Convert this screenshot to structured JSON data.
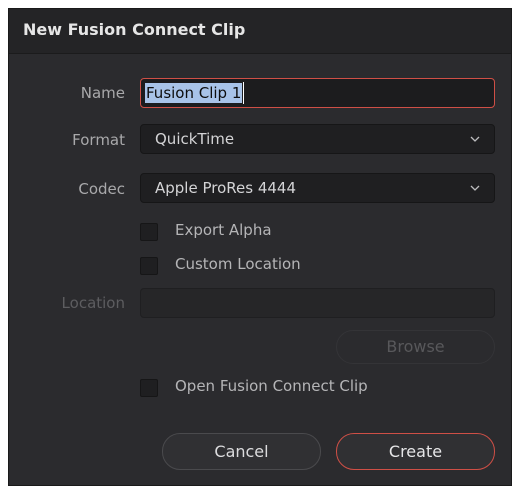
{
  "dialog": {
    "title": "New Fusion Connect Clip"
  },
  "form": {
    "name_label": "Name",
    "name_value": "Fusion Clip 1",
    "format_label": "Format",
    "format_value": "QuickTime",
    "codec_label": "Codec",
    "codec_value": "Apple ProRes 4444",
    "export_alpha_label": "Export Alpha",
    "export_alpha_checked": false,
    "custom_location_label": "Custom Location",
    "custom_location_checked": false,
    "location_label": "Location",
    "location_value": "",
    "browse_label": "Browse",
    "open_clip_label": "Open Fusion Connect Clip",
    "open_clip_checked": false
  },
  "actions": {
    "cancel_label": "Cancel",
    "create_label": "Create"
  },
  "colors": {
    "dialog_bg": "#2b2b2e",
    "accent": "#cf4f46",
    "selection": "#a8c3e8"
  }
}
